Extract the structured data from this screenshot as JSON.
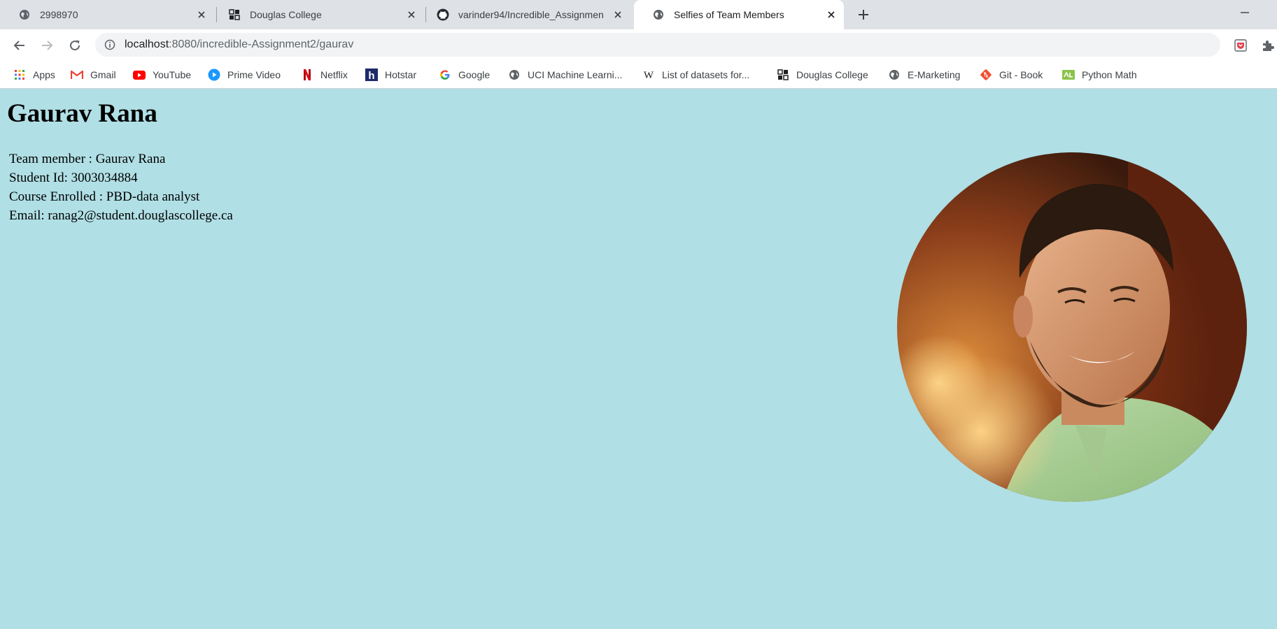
{
  "browser": {
    "tabs": [
      {
        "title": "2998970",
        "icon": "globe-icon",
        "active": false
      },
      {
        "title": "Douglas College",
        "icon": "douglas-college-icon",
        "active": false
      },
      {
        "title": "varinder94/Incredible_Assignmen",
        "icon": "github-icon",
        "active": false
      },
      {
        "title": "Selfies of Team Members",
        "icon": "globe-icon",
        "active": true
      }
    ],
    "address": {
      "host": "localhost",
      "path": ":8080/incredible-Assignment2/gaurav"
    },
    "bookmarks": [
      {
        "label": "Apps",
        "icon": "apps-grid-icon"
      },
      {
        "label": "Gmail",
        "icon": "gmail-icon"
      },
      {
        "label": "YouTube",
        "icon": "youtube-icon"
      },
      {
        "label": "Prime Video",
        "icon": "prime-video-icon"
      },
      {
        "label": "Netflix",
        "icon": "netflix-icon"
      },
      {
        "label": "Hotstar",
        "icon": "hotstar-icon"
      },
      {
        "label": "Google",
        "icon": "google-icon"
      },
      {
        "label": "UCI Machine Learni...",
        "icon": "globe-icon"
      },
      {
        "label": "List of datasets for...",
        "icon": "wikipedia-icon"
      },
      {
        "label": "Douglas College",
        "icon": "douglas-college-icon"
      },
      {
        "label": "E-Marketing",
        "icon": "globe-icon"
      },
      {
        "label": "Git - Book",
        "icon": "git-icon"
      },
      {
        "label": "Python Math",
        "icon": "python-math-icon"
      }
    ]
  },
  "page": {
    "heading": "Gaurav Rana",
    "team_member": "Team member : Gaurav Rana",
    "student_id": "Student Id: 3003034884",
    "course": "Course Enrolled : PBD-data analyst",
    "email": "Email: ranag2@student.douglascollege.ca",
    "photo": "team-member-selfie-photo"
  },
  "colors": {
    "page_background": "#b0dfe5",
    "tabstrip_background": "#dee1e6"
  }
}
